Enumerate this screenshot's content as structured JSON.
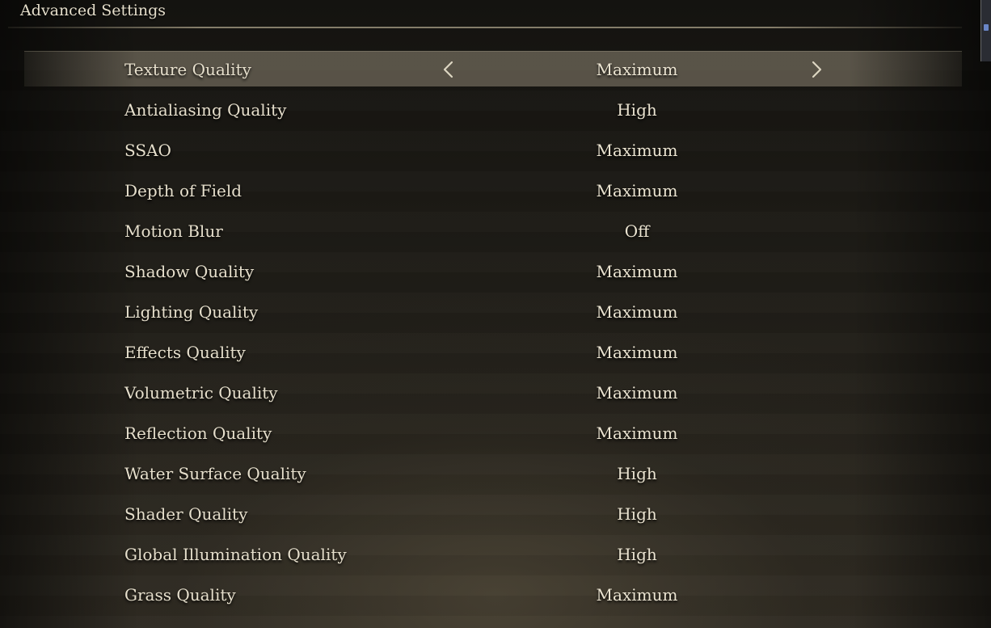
{
  "header": {
    "title": "Advanced Settings"
  },
  "icons": {
    "prev": "chevron-left-icon",
    "next": "chevron-right-icon"
  },
  "colors": {
    "text": "#e6dfcc",
    "selected_row": "#807868",
    "rule": "#aaa087"
  },
  "settings": [
    {
      "label": "Texture Quality",
      "value": "Maximum",
      "selected": true
    },
    {
      "label": "Antialiasing Quality",
      "value": "High",
      "selected": false
    },
    {
      "label": "SSAO",
      "value": "Maximum",
      "selected": false
    },
    {
      "label": "Depth of Field",
      "value": "Maximum",
      "selected": false
    },
    {
      "label": "Motion Blur",
      "value": "Off",
      "selected": false
    },
    {
      "label": "Shadow Quality",
      "value": "Maximum",
      "selected": false
    },
    {
      "label": "Lighting Quality",
      "value": "Maximum",
      "selected": false
    },
    {
      "label": "Effects Quality",
      "value": "Maximum",
      "selected": false
    },
    {
      "label": "Volumetric Quality",
      "value": "Maximum",
      "selected": false
    },
    {
      "label": "Reflection Quality",
      "value": "Maximum",
      "selected": false
    },
    {
      "label": "Water Surface Quality",
      "value": "High",
      "selected": false
    },
    {
      "label": "Shader Quality",
      "value": "High",
      "selected": false
    },
    {
      "label": "Global Illumination Quality",
      "value": "High",
      "selected": false
    },
    {
      "label": "Grass Quality",
      "value": "Maximum",
      "selected": false
    }
  ]
}
